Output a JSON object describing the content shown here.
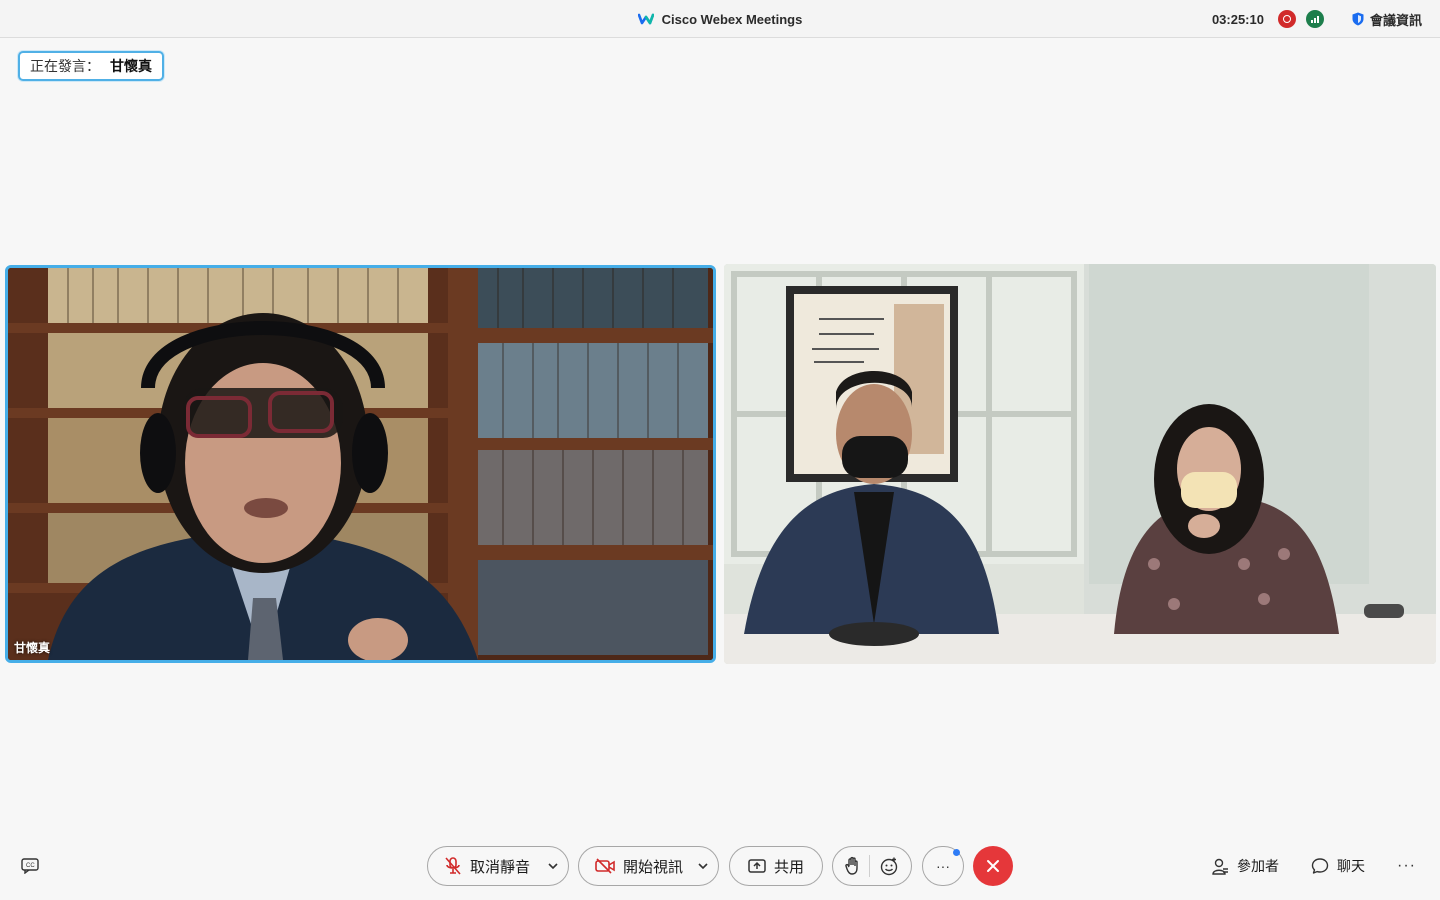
{
  "titlebar": {
    "app_title": "Cisco Webex Meetings",
    "timer": "03:25:10",
    "meeting_info_label": "會議資訊"
  },
  "speaking": {
    "label": "正在發言：",
    "name": "甘懷真"
  },
  "tiles": [
    {
      "participant_name": "甘懷真",
      "active_speaker": true
    },
    {
      "participant_name": "",
      "active_speaker": false
    }
  ],
  "controls": {
    "mute_label": "取消靜音",
    "video_label": "開始視訊",
    "share_label": "共用",
    "more_label": "···",
    "participants_label": "參加者",
    "chat_label": "聊天",
    "overflow_label": "···"
  },
  "colors": {
    "accent": "#46aee8",
    "end_call": "#e5373a",
    "recording": "#d12a2a",
    "network": "#1d7e4c"
  },
  "icons": [
    "webex-logo-icon",
    "recording-icon",
    "network-signal-icon",
    "shield-icon",
    "captions-icon",
    "mic-muted-icon",
    "chevron-down-icon",
    "video-off-icon",
    "share-icon",
    "raise-hand-icon",
    "emoji-reaction-icon",
    "end-call-icon",
    "participants-icon",
    "chat-icon",
    "more-options-icon"
  ]
}
